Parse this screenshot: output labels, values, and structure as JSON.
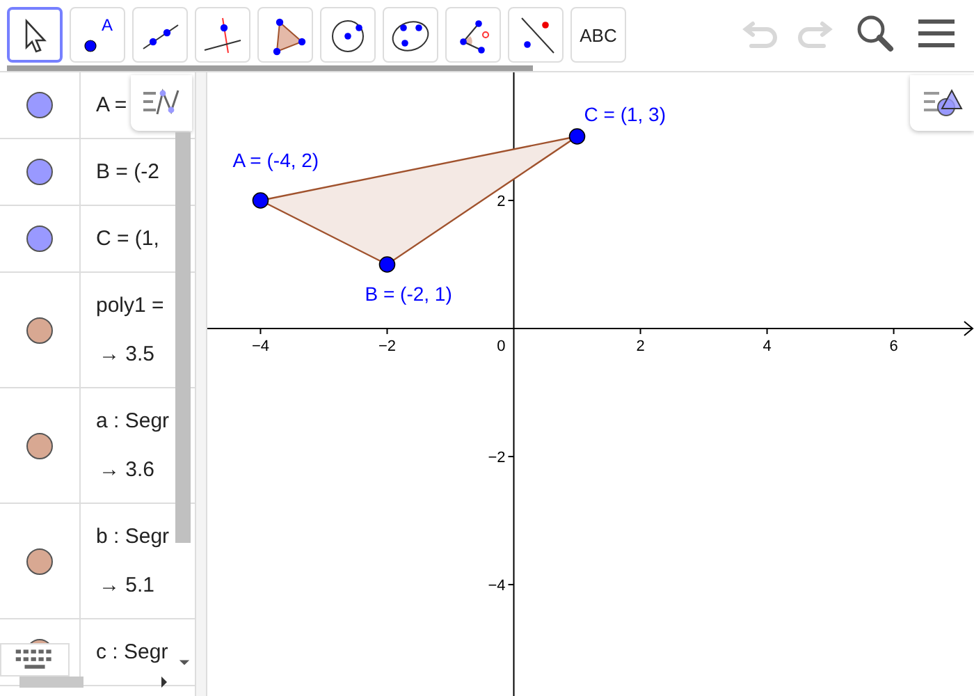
{
  "toolbar": {
    "tools": [
      {
        "kind": "move",
        "selected": true
      },
      {
        "kind": "point",
        "label": "A",
        "selected": false
      },
      {
        "kind": "line",
        "selected": false
      },
      {
        "kind": "perpendicular",
        "selected": false
      },
      {
        "kind": "polygon",
        "selected": false
      },
      {
        "kind": "circle",
        "selected": false
      },
      {
        "kind": "conic",
        "selected": false
      },
      {
        "kind": "angle",
        "selected": false
      },
      {
        "kind": "reflect",
        "selected": false
      },
      {
        "kind": "text",
        "label": "ABC",
        "selected": false
      }
    ],
    "undo": {
      "disabled": true
    },
    "redo": {
      "disabled": true
    }
  },
  "algebra": {
    "items": [
      {
        "color": "#9999ff",
        "name": "A ="
      },
      {
        "color": "#9999ff",
        "name": "B = (-2"
      },
      {
        "color": "#9999ff",
        "name": "C = (1,"
      },
      {
        "color": "#d8a892",
        "name": "poly1 =",
        "value": "→ 3.5"
      },
      {
        "color": "#d8a892",
        "name": "a : Segr",
        "value": "→ 3.6"
      },
      {
        "color": "#d8a892",
        "name": "b : Segr",
        "value": "→ 5.1"
      },
      {
        "color": "#d8a892",
        "name": "c : Segr"
      }
    ]
  },
  "graphics": {
    "chart_data": {
      "type": "scatter",
      "x": [
        -4,
        -2,
        1
      ],
      "values": [
        2,
        1,
        3
      ],
      "xlim": [
        -4.84,
        7.29
      ],
      "ylim": [
        -5.74,
        4
      ],
      "xticks": [
        {
          "value": -4,
          "label": "−4"
        },
        {
          "value": -2,
          "label": "−2"
        },
        {
          "value": 2,
          "label": "2"
        },
        {
          "value": 4,
          "label": "4"
        },
        {
          "value": 6,
          "label": "6"
        }
      ],
      "yticks": [
        {
          "value": -4,
          "label": "−4"
        },
        {
          "value": -2,
          "label": "−2"
        },
        {
          "value": 2,
          "label": "2"
        }
      ],
      "annotations": [
        "A = (-4, 2)",
        "B = (-2, 1)",
        "C = (1, 3)"
      ]
    },
    "origin_label": "0"
  }
}
